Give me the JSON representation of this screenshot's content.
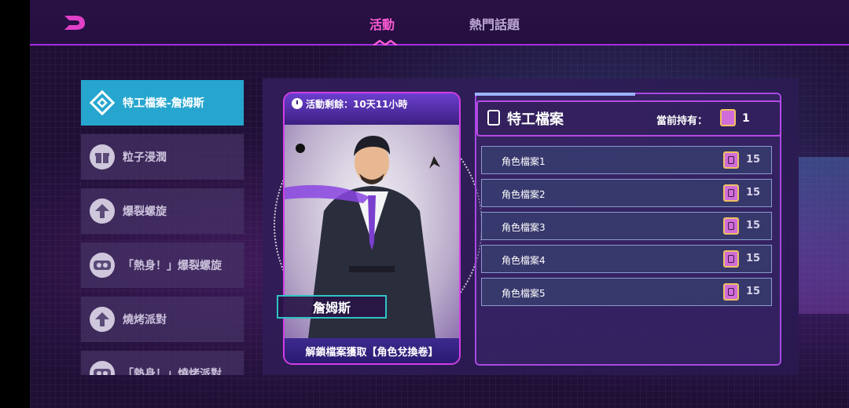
{
  "header": {
    "tabs": [
      {
        "label": "活動",
        "active": true
      },
      {
        "label": "熱門話題",
        "active": false
      }
    ]
  },
  "sidebar": {
    "items": [
      {
        "label": "特工檔案-詹姆斯",
        "icon": "diamond-chain-icon",
        "active": true
      },
      {
        "label": "粒子浸潤",
        "icon": "gift-icon",
        "active": false
      },
      {
        "label": "爆裂螺旋",
        "icon": "up-arrow-icon",
        "active": false
      },
      {
        "label": "「熱身！」爆裂螺旋",
        "icon": "vr-goggles-icon",
        "active": false
      },
      {
        "label": "燒烤派對",
        "icon": "up-arrow-icon",
        "active": false
      },
      {
        "label": "「熱身！」燒烤派對",
        "icon": "vr-goggles-icon",
        "active": false
      }
    ]
  },
  "card": {
    "timer": "活動剩餘：10天11小時",
    "character_name": "詹姆斯",
    "unlock_text": "解鎖檔案獲取【角色兌換卷】"
  },
  "panel": {
    "title": "特工檔案",
    "owned_label": "當前持有：",
    "owned_count": "1",
    "files": [
      {
        "label": "角色檔案1",
        "cost": "15"
      },
      {
        "label": "角色檔案2",
        "cost": "15"
      },
      {
        "label": "角色檔案3",
        "cost": "15"
      },
      {
        "label": "角色檔案4",
        "cost": "15"
      },
      {
        "label": "角色檔案5",
        "cost": "15"
      }
    ]
  },
  "colors": {
    "active_tab": "#ff5cd6",
    "active_sidebar": "#26a6cf",
    "accent_border": "#d23ee6"
  }
}
